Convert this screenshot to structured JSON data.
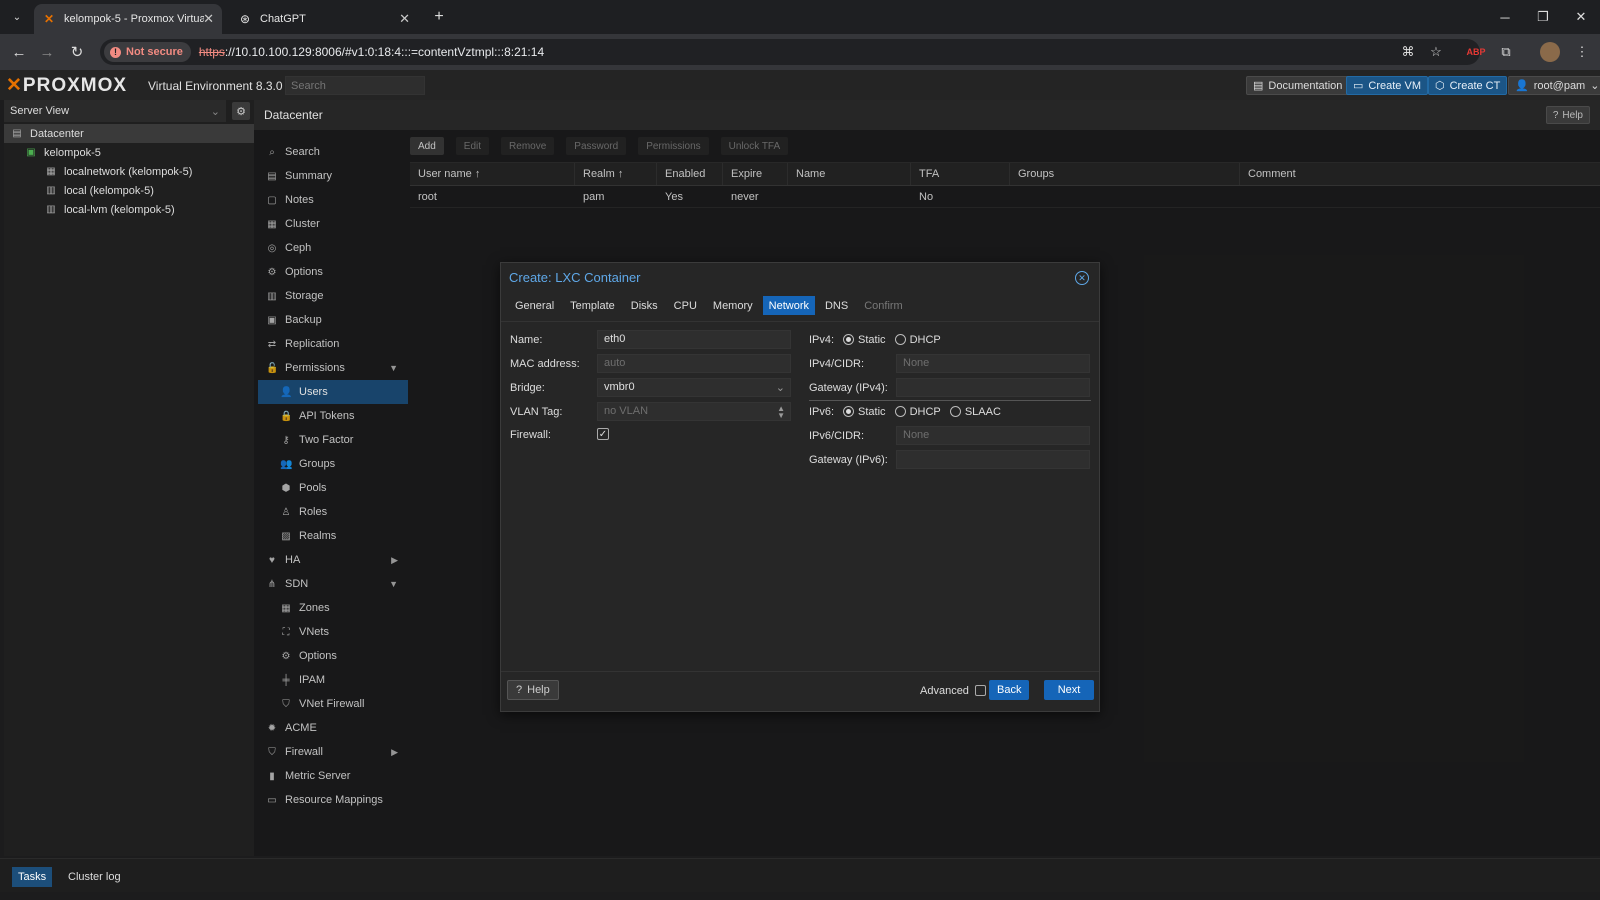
{
  "browser": {
    "tabs": [
      {
        "title": "kelompok-5 - Proxmox Virtual E",
        "icon": "proxmox-icon",
        "active": true
      },
      {
        "title": "ChatGPT",
        "icon": "chatgpt-icon",
        "active": false
      }
    ],
    "security_label": "Not secure",
    "url_scheme": "https",
    "url_rest": "://10.10.100.129:8006/#v1:0:18:4:::=contentVztmpl:::8:21:14"
  },
  "header": {
    "logo": "PROXMOX",
    "version": "Virtual Environment 8.3.0",
    "search_placeholder": "Search",
    "buttons": {
      "documentation": "Documentation",
      "create_vm": "Create VM",
      "create_ct": "Create CT",
      "user": "root@pam"
    }
  },
  "sidebar": {
    "view": "Server View",
    "tree": [
      {
        "label": "Datacenter",
        "icon": "datacenter-icon",
        "level": 0
      },
      {
        "label": "kelompok-5",
        "icon": "node-icon",
        "level": 1
      },
      {
        "label": "localnetwork (kelompok-5)",
        "icon": "network-icon",
        "level": 2
      },
      {
        "label": "local (kelompok-5)",
        "icon": "storage-icon",
        "level": 2
      },
      {
        "label": "local-lvm (kelompok-5)",
        "icon": "storage-icon",
        "level": 2
      }
    ]
  },
  "content": {
    "title": "Datacenter",
    "help": "Help",
    "menu": [
      {
        "label": "Search",
        "icon": "search-icon"
      },
      {
        "label": "Summary",
        "icon": "summary-icon"
      },
      {
        "label": "Notes",
        "icon": "notes-icon"
      },
      {
        "label": "Cluster",
        "icon": "cluster-icon"
      },
      {
        "label": "Ceph",
        "icon": "ceph-icon"
      },
      {
        "label": "Options",
        "icon": "gear-icon"
      },
      {
        "label": "Storage",
        "icon": "storage-icon"
      },
      {
        "label": "Backup",
        "icon": "backup-icon"
      },
      {
        "label": "Replication",
        "icon": "replication-icon"
      },
      {
        "label": "Permissions",
        "icon": "unlock-icon",
        "arrow": "▼"
      },
      {
        "label": "Users",
        "icon": "user-icon",
        "sub": true,
        "selected": true
      },
      {
        "label": "API Tokens",
        "icon": "lock-icon",
        "sub": true
      },
      {
        "label": "Two Factor",
        "icon": "key-icon",
        "sub": true
      },
      {
        "label": "Groups",
        "icon": "users-icon",
        "sub": true
      },
      {
        "label": "Pools",
        "icon": "tags-icon",
        "sub": true
      },
      {
        "label": "Roles",
        "icon": "male-icon",
        "sub": true
      },
      {
        "label": "Realms",
        "icon": "address-book-icon",
        "sub": true
      },
      {
        "label": "HA",
        "icon": "heartbeat-icon",
        "arrow": "▶"
      },
      {
        "label": "SDN",
        "icon": "sdn-icon",
        "arrow": "▼"
      },
      {
        "label": "Zones",
        "icon": "zones-icon",
        "sub": true
      },
      {
        "label": "VNets",
        "icon": "vnets-icon",
        "sub": true
      },
      {
        "label": "Options",
        "icon": "gear-icon",
        "sub": true
      },
      {
        "label": "IPAM",
        "icon": "ipam-icon",
        "sub": true
      },
      {
        "label": "VNet Firewall",
        "icon": "shield-icon",
        "sub": true
      },
      {
        "label": "ACME",
        "icon": "certificate-icon"
      },
      {
        "label": "Firewall",
        "icon": "shield-icon",
        "arrow": "▶"
      },
      {
        "label": "Metric Server",
        "icon": "bar-chart-icon"
      },
      {
        "label": "Resource Mappings",
        "icon": "folder-icon"
      }
    ],
    "toolbar": {
      "add": "Add",
      "edit": "Edit",
      "remove": "Remove",
      "password": "Password",
      "permissions": "Permissions",
      "unlock_tfa": "Unlock TFA"
    },
    "grid": {
      "columns": [
        "User name ↑",
        "Realm ↑",
        "Enabled",
        "Expire",
        "Name",
        "TFA",
        "Groups",
        "Comment"
      ],
      "rows": [
        [
          "root",
          "pam",
          "Yes",
          "never",
          "",
          "No",
          "",
          ""
        ]
      ]
    }
  },
  "dialog": {
    "title": "Create: LXC Container",
    "tabs": [
      "General",
      "Template",
      "Disks",
      "CPU",
      "Memory",
      "Network",
      "DNS",
      "Confirm"
    ],
    "active_tab": "Network",
    "left": {
      "name_label": "Name:",
      "name_value": "eth0",
      "mac_label": "MAC address:",
      "mac_placeholder": "auto",
      "bridge_label": "Bridge:",
      "bridge_value": "vmbr0",
      "vlan_label": "VLAN Tag:",
      "vlan_placeholder": "no VLAN",
      "firewall_label": "Firewall:",
      "firewall_checked": true
    },
    "right": {
      "ipv4_label": "IPv4:",
      "ipv4_options": [
        "Static",
        "DHCP"
      ],
      "ipv4_selected": "Static",
      "ipv4cidr_label": "IPv4/CIDR:",
      "ipv4cidr_placeholder": "None",
      "gw4_label": "Gateway (IPv4):",
      "gw4_value": "",
      "ipv6_label": "IPv6:",
      "ipv6_options": [
        "Static",
        "DHCP",
        "SLAAC"
      ],
      "ipv6_selected": "Static",
      "ipv6cidr_label": "IPv6/CIDR:",
      "ipv6cidr_placeholder": "None",
      "gw6_label": "Gateway (IPv6):",
      "gw6_value": ""
    },
    "footer": {
      "help": "Help",
      "advanced": "Advanced",
      "back": "Back",
      "next": "Next"
    }
  },
  "bottom": {
    "tabs": [
      "Tasks",
      "Cluster log"
    ],
    "active": "Tasks"
  }
}
